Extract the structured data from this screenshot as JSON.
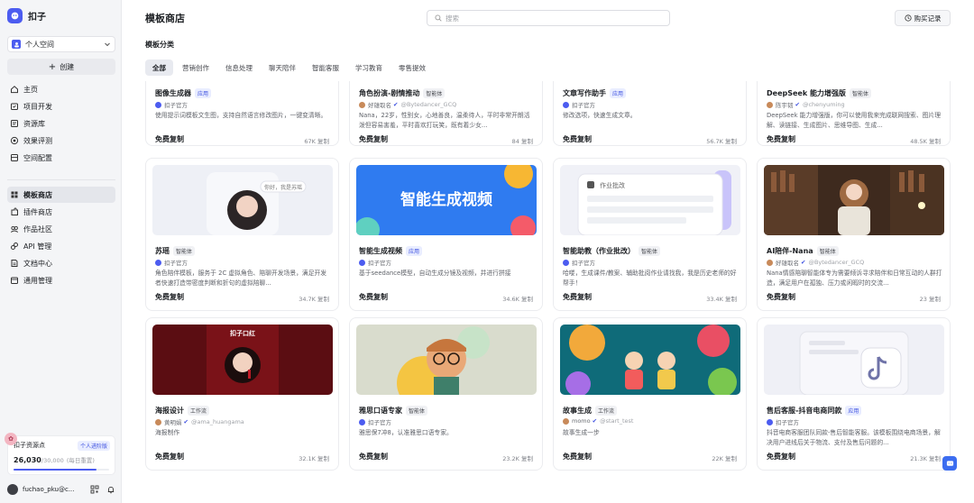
{
  "sidebar": {
    "brand": "扣子",
    "space": "个人空间",
    "create_label": "创建",
    "nav_top": [
      {
        "label": "主页",
        "icon": "home-icon"
      },
      {
        "label": "项目开发",
        "icon": "project-icon"
      },
      {
        "label": "资源库",
        "icon": "library-icon"
      },
      {
        "label": "效果评测",
        "icon": "evaluation-icon"
      },
      {
        "label": "空间配置",
        "icon": "settings-icon"
      }
    ],
    "nav_bottom": [
      {
        "label": "模板商店",
        "icon": "store-icon",
        "active": true
      },
      {
        "label": "插件商店",
        "icon": "plugin-icon"
      },
      {
        "label": "作品社区",
        "icon": "community-icon"
      },
      {
        "label": "API 管理",
        "icon": "api-icon"
      },
      {
        "label": "文档中心",
        "icon": "docs-icon"
      },
      {
        "label": "通用管理",
        "icon": "manage-icon"
      }
    ],
    "resource": {
      "title": "扣子资源点",
      "badge": "个人进阶版",
      "value": "26,030",
      "total": "/30,000",
      "note": "(每日重置)",
      "used_fraction": 0.87
    },
    "user": {
      "name": "fuchao_pku@c..."
    }
  },
  "header": {
    "title": "模板商店",
    "search_placeholder": "搜索",
    "purchase_label": "购买记录"
  },
  "category_label": "模板分类",
  "tabs": [
    "全部",
    "营销创作",
    "信息处理",
    "聊天陪伴",
    "智能客服",
    "学习教育",
    "零售提效"
  ],
  "active_tab": 0,
  "cards": [
    {
      "title": "图像生成器",
      "tag": "应用",
      "tag_type": "app",
      "author": "扣子官方",
      "handle": "",
      "desc": "使用提示词模板文生图，支持自然语言修改图片，一键变清晰。",
      "price": "免费复制",
      "count": "67K 复制",
      "img": "none"
    },
    {
      "title": "角色扮演-剧情推动",
      "tag": "智能体",
      "tag_type": "agent",
      "author": "好雄取名",
      "handle": "@Bytedancer_GCQ",
      "desc": "Nana，22岁，性别女，心地善良，温柔待人，平时非常开朗活泼但容易害羞，平时喜欢打玩笑，既有着少女...",
      "price": "免费复制",
      "count": "84 复制",
      "img": "none"
    },
    {
      "title": "文章写作助手",
      "tag": "应用",
      "tag_type": "app",
      "author": "扣子官方",
      "handle": "",
      "desc": "修改选项，快速生成文章。",
      "price": "免费复制",
      "count": "56.7K 复制",
      "img": "none"
    },
    {
      "title": "DeepSeek 能力增强版",
      "tag": "智能体",
      "tag_type": "agent",
      "author": "陈宇韧",
      "handle": "@chenyuming",
      "desc": "DeepSeek 能力增强版，你可以使用我来完成联网搜索、图片理解、读链接、生成图片、思维导图、生成...",
      "price": "免费复制",
      "count": "48.5K 复制",
      "img": "none"
    },
    {
      "title": "苏瑶",
      "tag": "智能体",
      "tag_type": "agent",
      "author": "扣子官方",
      "handle": "",
      "desc": "角色陪伴模板，服务于 2C 虚拟角色、陪聊开发场景，满足开发者快速打造带密度判断和折句的虚拟陪聊...",
      "price": "免费复制",
      "count": "34.7K 复制",
      "img": "portrait",
      "bubble": "你好，我是苏瑶"
    },
    {
      "title": "智能生成视频",
      "tag": "应用",
      "tag_type": "app",
      "author": "扣子官方",
      "handle": "",
      "desc": "基于seedance模型，自动生成分镜及视频，并进行拼接",
      "price": "免费复制",
      "count": "34.6K 复制",
      "img": "video",
      "banner": "智能生成视频"
    },
    {
      "title": "智能助教（作业批改）",
      "tag": "智能体",
      "tag_type": "agent",
      "author": "扣子官方",
      "handle": "",
      "desc": "哈喽，生成课件/教案、辅助批阅作业请找我，我是历史老师的好帮手！",
      "price": "免费复制",
      "count": "33.4K 复制",
      "img": "homework",
      "panel": "作业批改"
    },
    {
      "title": "AI陪伴-Nana",
      "tag": "智能体",
      "tag_type": "agent",
      "author": "好雄取名",
      "handle": "@Bytedancer_GCQ",
      "desc": "Nana情感陪聊智能体专为需要倾诉寻求陪伴和日常互动的人群打造，满足用户在孤独、压力或闲暇时的交流...",
      "price": "免费复制",
      "count": "23 复制",
      "img": "anime"
    },
    {
      "title": "海报设计",
      "tag": "工作流",
      "tag_type": "flow",
      "author": "黄明娟",
      "handle": "@ama_huangama",
      "desc": "海报制作",
      "price": "免费复制",
      "count": "32.1K 复制",
      "img": "poster",
      "poster_text": "扣子口红"
    },
    {
      "title": "雅思口语专家",
      "tag": "智能体",
      "tag_type": "agent",
      "author": "扣子官方",
      "handle": "",
      "desc": "雅思保7冲8，认准雅思口语专家。",
      "price": "免费复制",
      "count": "23.2K 复制",
      "img": "glasses"
    },
    {
      "title": "故事生成",
      "tag": "工作流",
      "tag_type": "flow",
      "author": "momo",
      "handle": "@start_test",
      "desc": "故事生成一步",
      "price": "免费复制",
      "count": "22K 复制",
      "img": "story"
    },
    {
      "title": "售后客服-抖音电商同款",
      "tag": "应用",
      "tag_type": "app",
      "author": "扣子官方",
      "handle": "",
      "desc": "抖音电商客服团队同款-售后智能客服。该模板围绕电商场景，解决用户进线后关于物流、支付及售后问题的...",
      "price": "免费复制",
      "count": "21.3K 复制",
      "img": "tiktok"
    }
  ]
}
